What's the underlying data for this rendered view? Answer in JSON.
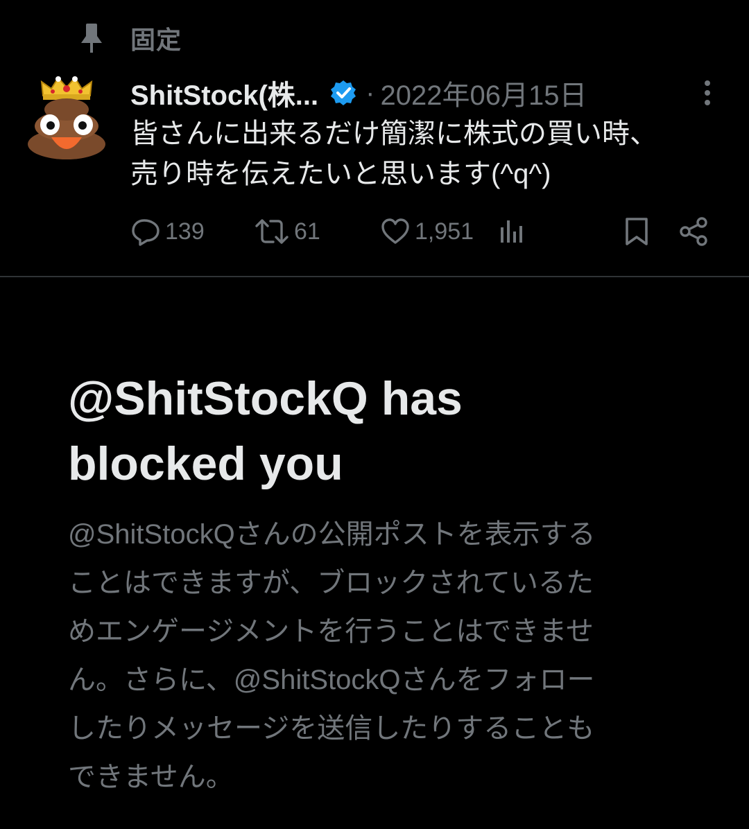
{
  "pinned": {
    "label": "固定",
    "icon": "pin-icon"
  },
  "post": {
    "avatar_icon": "crowned-poop-avatar",
    "display_name": "ShitStock(株...",
    "verified_icon": "verified-badge-icon",
    "verified_color": "#1d9bf0",
    "separator": "·",
    "date": "2022年06月15日",
    "text_lines": [
      "皆さんに出来るだけ簡潔に株式の買い時、",
      "売り時を伝えたいと思います(^q^)"
    ],
    "actions": {
      "reply": {
        "icon": "reply-icon",
        "count": "139"
      },
      "repost": {
        "icon": "repost-icon",
        "count": "61"
      },
      "like": {
        "icon": "heart-icon",
        "count": "1,951"
      },
      "views": {
        "icon": "analytics-icon"
      },
      "bookmark": {
        "icon": "bookmark-icon"
      },
      "share": {
        "icon": "share-icon"
      }
    }
  },
  "blocked": {
    "title_lines": [
      "@ShitStockQ has",
      "blocked you"
    ],
    "body_lines": [
      "@ShitStockQさんの公開ポストを表示する",
      "ことはできますが、ブロックされているた",
      "めエンゲージメントを行うことはできませ",
      "ん。さらに、@ShitStockQさんをフォロー",
      "したりメッセージを送信したりすることも",
      "できません。"
    ]
  },
  "colors": {
    "background": "#000000",
    "primary_text": "#e7e9ea",
    "secondary_text": "#71767b",
    "divider": "#2f3336"
  }
}
